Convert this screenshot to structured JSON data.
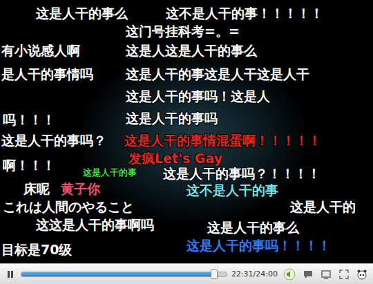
{
  "player": {
    "danmaku": [
      {
        "text": "这是人干的事么",
        "color": "#ffffff",
        "kind": "large"
      },
      {
        "text": "这不是人干的事！！！！！",
        "color": "#ffffff",
        "kind": "large"
      },
      {
        "text": "这门号挂科考=。=",
        "color": "#ffffff",
        "kind": "large"
      },
      {
        "text": "有小说感人啊",
        "color": "#ffffff",
        "kind": "large"
      },
      {
        "text": "这是人这是人干的事么",
        "color": "#ffffff",
        "kind": "large"
      },
      {
        "text": "是人干的事情吗",
        "color": "#ffffff",
        "kind": "large"
      },
      {
        "text": "这是人干的事这是人干这是人干",
        "color": "#ffffff",
        "kind": "large"
      },
      {
        "text": "这是人干的事吗！这是人",
        "color": "#ffffff",
        "kind": "large"
      },
      {
        "text": "吗！！！",
        "color": "#ffffff",
        "kind": "large"
      },
      {
        "text": "这是人干的事吗",
        "color": "#ffffff",
        "kind": "large"
      },
      {
        "text": "这是人干的事吗？",
        "color": "#ffffff",
        "kind": "large"
      },
      {
        "text": "这是人干的事情混蛋啊！！！！！",
        "color": "#e8261e",
        "kind": "large"
      },
      {
        "text": "啊！！！",
        "color": "#ffffff",
        "kind": "large"
      },
      {
        "text": "发疯Let's Gay",
        "color": "#e8261e",
        "kind": "large"
      },
      {
        "text": "这是人干的事",
        "color": "#3ddc3d",
        "kind": "small"
      },
      {
        "text": "这是人干的事吗？！！！！",
        "color": "#ffffff",
        "kind": "large"
      },
      {
        "text": "床呢",
        "color": "#ffffff",
        "kind": "large"
      },
      {
        "text": "黄子你",
        "color": "#f0506e",
        "kind": "large"
      },
      {
        "text": "这不是人干的事",
        "color": "#6fe6f0",
        "kind": "large"
      },
      {
        "text": "これは人間のやること",
        "color": "#ffffff",
        "kind": "large"
      },
      {
        "text": "这是人干的",
        "color": "#ffffff",
        "kind": "large"
      },
      {
        "text": "这这是人干的事啊吗",
        "color": "#ffffff",
        "kind": "large"
      },
      {
        "text": "这是人干的事么",
        "color": "#ffffff",
        "kind": "large"
      },
      {
        "text": "目标是70级",
        "color": "#ffffff",
        "kind": "large"
      },
      {
        "text": "这是人干的事吗！！！！",
        "color": "#2f7cf6",
        "kind": "large"
      }
    ],
    "controls": {
      "playing": true,
      "progress": {
        "level": 0.938
      },
      "time": "22:31/24:00"
    }
  }
}
